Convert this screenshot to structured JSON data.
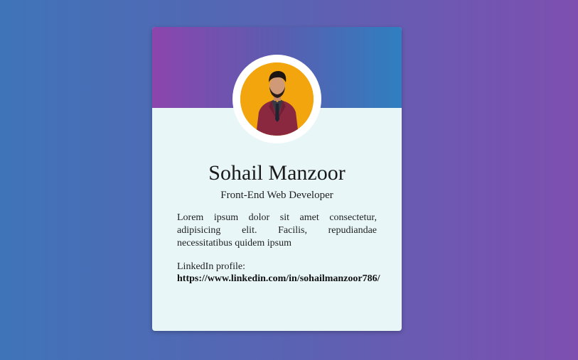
{
  "profile": {
    "name": "Sohail Manzoor",
    "role": "Front-End Web Developer",
    "bio": "Lorem ipsum dolor sit amet consectetur, adipisicing elit. Facilis, repudiandae necessitatibus quidem ipsum",
    "linkedin_label": "LinkedIn profile:",
    "linkedin_url": "https://www.linkedin.com/in/sohailmanzoor786/"
  },
  "colors": {
    "background_start": "#3f74b8",
    "background_end": "#7e4fb0",
    "header_start": "#8c45ad",
    "header_end": "#2f7fc0",
    "card_body": "#e8f6f7",
    "avatar_bg": "#f2a50c"
  }
}
